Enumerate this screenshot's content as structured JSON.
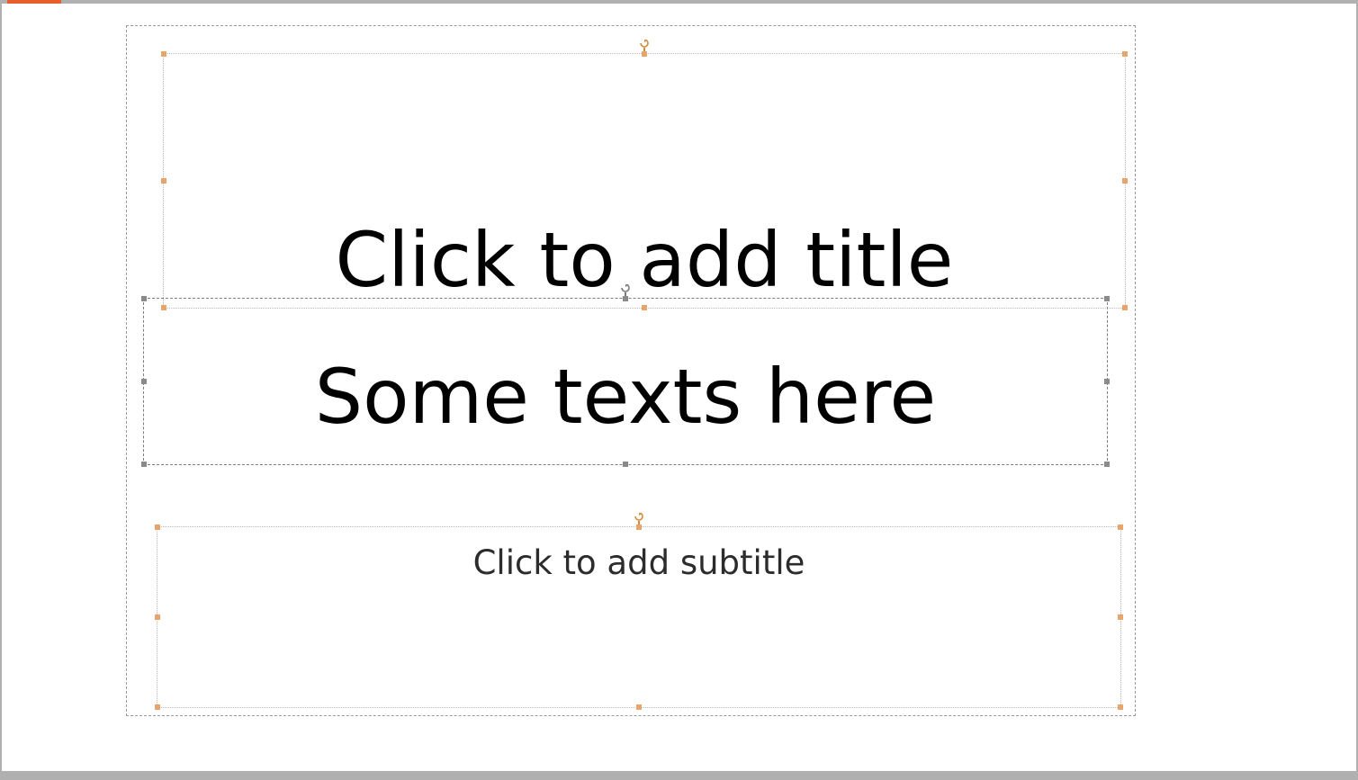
{
  "slide": {
    "title_placeholder": "Click to add title",
    "textbox_text": "Some texts here",
    "subtitle_placeholder": "Click to add subtitle"
  },
  "colors": {
    "handle_orange": "#e8a56b",
    "handle_gray": "#8a8a8a",
    "accent_tab": "#e85d2c"
  }
}
